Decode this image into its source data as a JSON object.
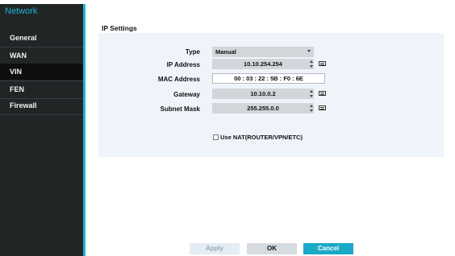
{
  "sidebar": {
    "title": "Network",
    "items": [
      {
        "label": "General",
        "active": false
      },
      {
        "label": "WAN",
        "active": false
      },
      {
        "label": "VIN",
        "active": true
      },
      {
        "label": "FEN",
        "active": false
      },
      {
        "label": "Firewall",
        "active": false
      }
    ]
  },
  "ip_settings": {
    "section_title": "IP Settings",
    "type_label": "Type",
    "type_value": "Manual",
    "ip_label": "IP Address",
    "ip_value": "10.10.254.254",
    "mac_label": "MAC Address",
    "mac_value": "00 : 03 : 22 : 5B : F0 : 6E",
    "gateway_label": "Gateway",
    "gateway_value": "10.10.0.2",
    "subnet_label": "Subnet Mask",
    "subnet_value": "255.255.0.0",
    "use_nat_label": "Use NAT(ROUTER/VPN/ETC)",
    "use_nat_checked": false
  },
  "footer": {
    "apply_label": "Apply",
    "ok_label": "OK",
    "cancel_label": "Cancel"
  },
  "colors": {
    "accent": "#19b6d6",
    "sidebar_bg": "#222526",
    "panel_bg": "#eef4fa"
  }
}
